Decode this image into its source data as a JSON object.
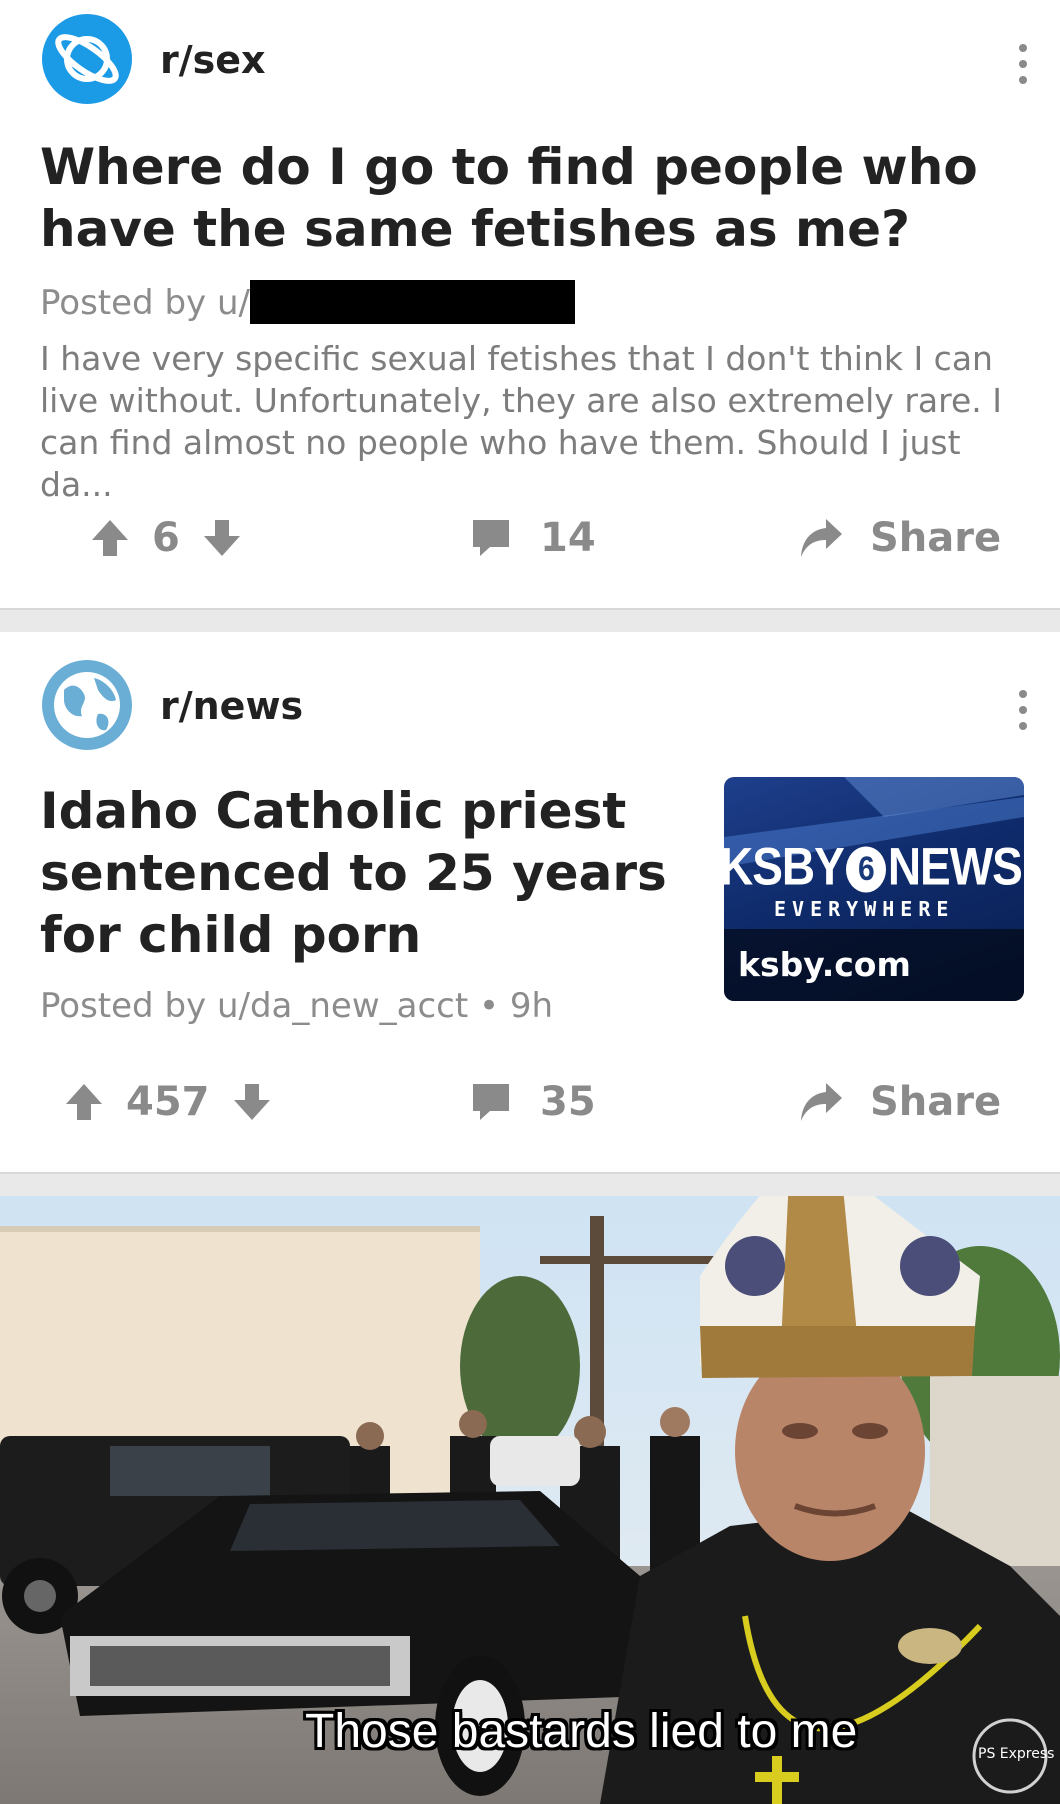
{
  "posts": [
    {
      "subreddit": "r/sex",
      "title": "Where do I go to find people who have the same fetishes as me?",
      "posted_by": "Posted by u/",
      "excerpt": "I have very specific sexual fetishes that I don't think I can live without. Unfortunately, they are also extremely rare. I can find almost no people who have them. Should I just da...",
      "votes": "6",
      "comments": "14",
      "share_label": "Share",
      "avatar_color": "#1b9ae6"
    },
    {
      "subreddit": "r/news",
      "title": "Idaho Catholic priest sentenced to 25 years for child porn",
      "posted_by": "Posted by u/da_new_acct • 9h",
      "votes": "457",
      "comments": "35",
      "share_label": "Share",
      "avatar_color": "#6aaed6",
      "thumbnail": {
        "logo": "KSBY",
        "channel": "6",
        "news": "NEWS",
        "tagline": "EVERYWHERE",
        "domain": "ksby.com"
      }
    }
  ],
  "meme": {
    "caption": "Those bastards lied to me",
    "watermark": "PS Express"
  }
}
